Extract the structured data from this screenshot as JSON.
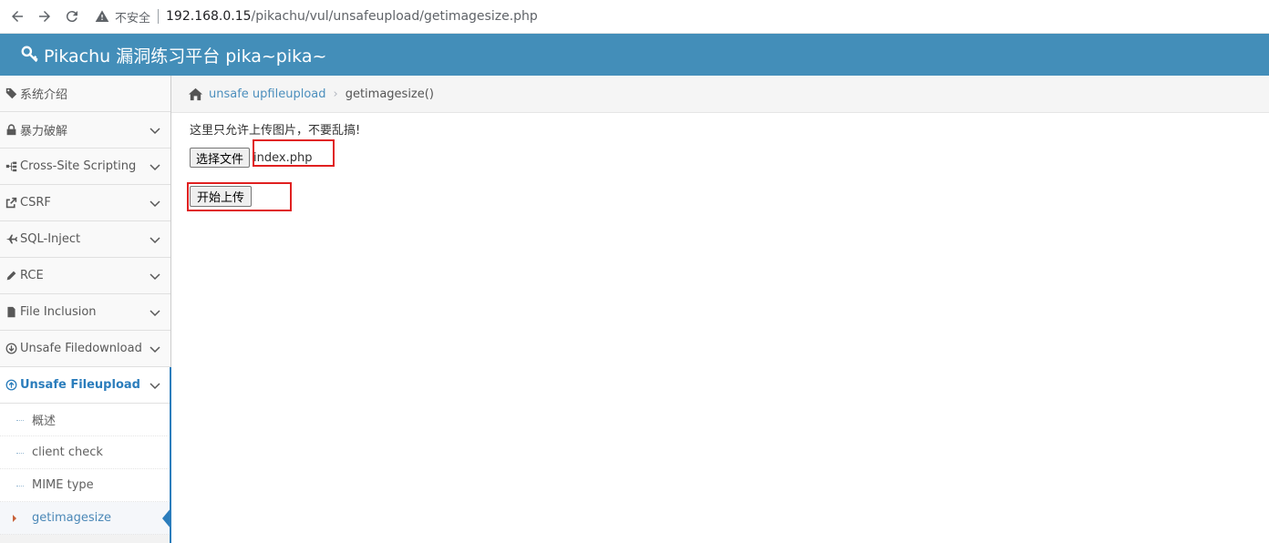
{
  "browser": {
    "insecure_label": "不安全",
    "url_host": "192.168.0.15",
    "url_path": "/pikachu/vul/unsafeupload/getimagesize.php"
  },
  "header": {
    "title": "Pikachu 漏洞练习平台 pika~pika~"
  },
  "sidebar": {
    "items": [
      {
        "label": "系统介绍",
        "icon": "tag-icon"
      },
      {
        "label": "暴力破解",
        "icon": "lock-icon"
      },
      {
        "label": "Cross-Site Scripting",
        "icon": "sitemap-icon"
      },
      {
        "label": "CSRF",
        "icon": "share-icon"
      },
      {
        "label": "SQL-Inject",
        "icon": "plane-icon"
      },
      {
        "label": "RCE",
        "icon": "pencil-icon"
      },
      {
        "label": "File Inclusion",
        "icon": "file-icon"
      },
      {
        "label": "Unsafe Filedownload",
        "icon": "download-icon"
      },
      {
        "label": "Unsafe Fileupload",
        "icon": "upload-icon"
      }
    ],
    "subitems": [
      {
        "label": "概述"
      },
      {
        "label": "client check"
      },
      {
        "label": "MIME type"
      },
      {
        "label": "getimagesize"
      }
    ]
  },
  "breadcrumb": {
    "parent": "unsafe upfileupload",
    "current": "getimagesize()"
  },
  "main": {
    "notice": "这里只允许上传图片，不要乱搞!",
    "choose_file_label": "选择文件",
    "file_name": "index.php",
    "upload_label": "开始上传"
  },
  "colors": {
    "header_bg": "#438eb9",
    "accent": "#2b7dbc",
    "highlight": "#e02020"
  }
}
